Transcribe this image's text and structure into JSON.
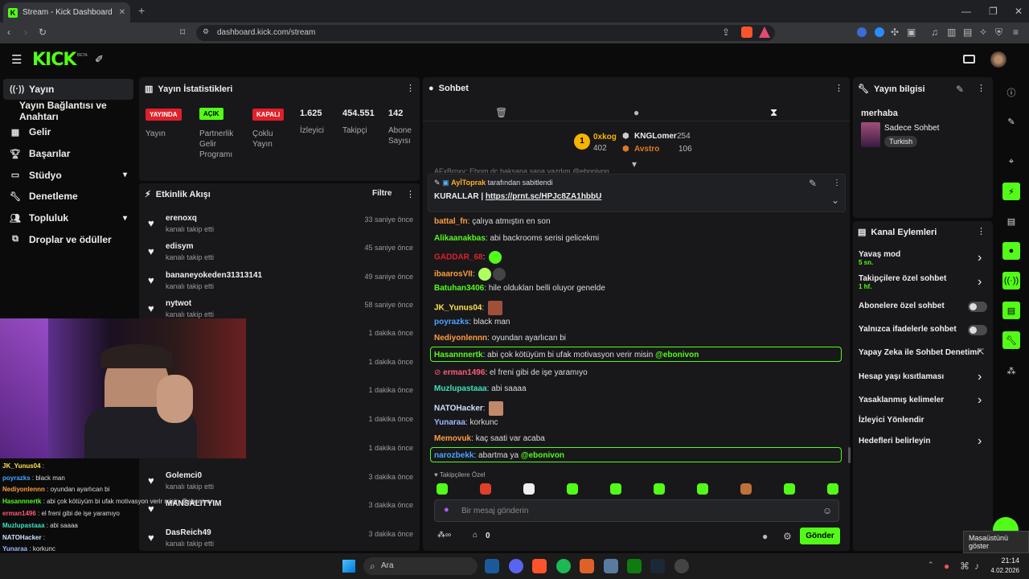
{
  "browser": {
    "tab_title": "Stream - Kick Dashboard",
    "new_tab": "+",
    "url": "dashboard.kick.com/stream"
  },
  "header": {
    "logo": "KICK",
    "beta": "BETA"
  },
  "sidebar": {
    "items": [
      {
        "label": "Yayın",
        "icon": "broadcast-icon"
      },
      {
        "label": "Yayın Bağlantısı ve Anahtarı",
        "icon": ""
      },
      {
        "label": "Gelir",
        "icon": "revenue-icon"
      },
      {
        "label": "Başarılar",
        "icon": "trophy-icon"
      },
      {
        "label": "Stüdyo",
        "icon": "studio-icon"
      },
      {
        "label": "Denetleme",
        "icon": "wrench-icon"
      },
      {
        "label": "Topluluk",
        "icon": "people-icon"
      },
      {
        "label": "Droplar ve ödüller",
        "icon": "drops-icon"
      }
    ]
  },
  "stats": {
    "title": "Yayın İstatistikleri",
    "badges": [
      {
        "badge": "YAYINDA",
        "label": "Yayın",
        "color": "#e0202a"
      },
      {
        "badge": "AÇIK",
        "label": "Partnerlik Gelir Programı",
        "color": "#53fc18"
      },
      {
        "badge": "KAPALI",
        "label": "Çoklu Yayın",
        "color": "#e0202a"
      }
    ],
    "nums": [
      {
        "value": "1.625",
        "label": "İzleyici"
      },
      {
        "value": "454.551",
        "label": "Takipçi"
      },
      {
        "value": "142",
        "label": "Abone Sayısı"
      }
    ]
  },
  "activity": {
    "title": "Etkinlik Akışı",
    "filter": "Filtre",
    "items": [
      {
        "name": "erenoxq",
        "sub": "kanalı takip etti",
        "time": "33 saniye önce"
      },
      {
        "name": "edisym",
        "sub": "kanalı takip etti",
        "time": "45 saniye önce"
      },
      {
        "name": "bananeyokeden31313141",
        "sub": "kanalı takip etti",
        "time": "49 saniye önce"
      },
      {
        "name": "nytwot",
        "sub": "kanalı takip etti",
        "time": "58 saniye önce"
      },
      {
        "name": "",
        "sub": "",
        "time": "1 dakika önce"
      },
      {
        "name": "",
        "sub": "",
        "time": "1 dakika önce"
      },
      {
        "name": "",
        "sub": "",
        "time": "1 dakika önce"
      },
      {
        "name": "",
        "sub": "",
        "time": "1 dakika önce"
      },
      {
        "name": "",
        "sub": "",
        "time": "1 dakika önce"
      },
      {
        "name": "Golemci0",
        "sub": "kanalı takip etti",
        "time": "3 dakika önce"
      },
      {
        "name": "MANSALITYIM",
        "sub": "",
        "time": "3 dakika önce"
      },
      {
        "name": "DasReich49",
        "sub": "kanalı takip etti",
        "time": "3 dakika önce"
      }
    ]
  },
  "chat": {
    "title": "Sohbet",
    "leaders": [
      {
        "name": "0xkog",
        "val": "402",
        "rank": "1"
      },
      {
        "name": "KNGLomer",
        "val": "254"
      },
      {
        "name": "Avstro",
        "val": "106"
      }
    ],
    "partial": "AFxBroxy: Ebom dc baksana sana yazdım @ebonivon",
    "pinned_by": "AyİToprak",
    "pinned_text": "tarafından sabitlendi",
    "rules_label": "KURALLAR |",
    "rules_link": "https://prnt.sc/HPJc8ZA1hbbU",
    "messages": [
      {
        "user": "battal_fn",
        "color": "#ff9d3b",
        "text": "çalıya atmıştın en son"
      },
      {
        "user": "Alikaanakbas",
        "color": "#53fc18",
        "text": "abi backrooms serisi gelicekmi"
      },
      {
        "user": "GADDAR_68",
        "color": "#e0202a",
        "text": ""
      },
      {
        "user": "ibaarosVII",
        "color": "#ff9d3b",
        "text": ""
      },
      {
        "user": "Batuhan3406",
        "color": "#53fc18",
        "text": "hile oldukları belli oluyor genelde"
      },
      {
        "user": "JK_Yunus04",
        "color": "#ffe04a",
        "text": ""
      },
      {
        "user": "poyrazks",
        "color": "#4aa3ff",
        "text": "black man"
      },
      {
        "user": "Nediyonlennn",
        "color": "#ff9d3b",
        "text": "oyundan ayarlıcan bi"
      },
      {
        "user": "Hasannnertk",
        "color": "#53fc18",
        "text": "abi çok kötüyüm bi ufak motivasyon verir misin",
        "mention": "@ebonivon"
      },
      {
        "user": "erman1496",
        "color": "#ff5a7a",
        "text": "el freni gibi de işe yaramıyo"
      },
      {
        "user": "Muzlupastaaa",
        "color": "#3fe0c0",
        "text": "abi saaaa"
      },
      {
        "user": "NATOHacker",
        "color": "#cfe3ff",
        "text": ""
      },
      {
        "user": "Yunaraa",
        "color": "#9fb8ff",
        "text": "korkunc"
      },
      {
        "user": "Memovuk",
        "color": "#ff9d3b",
        "text": "kaç saati var acaba"
      },
      {
        "user": "narozbekk",
        "color": "#4aa3ff",
        "text": "abartma ya",
        "mention": "@ebonivon"
      }
    ],
    "followers_only": "Takipçilere Özel",
    "input_placeholder": "Bir mesaj gönderin",
    "points": "0",
    "send": "Gönder"
  },
  "info": {
    "title": "Yayın bilgisi",
    "stream_title": "merhaba",
    "category": "Sadece Sohbet",
    "tag": "Turkish"
  },
  "actions": {
    "title": "Kanal Eylemleri",
    "items": [
      {
        "label": "Yavaş mod",
        "sub": "5 sn.",
        "kind": "chevron"
      },
      {
        "label": "Takipçilere özel sohbet",
        "sub": "1 hf.",
        "kind": "chevron"
      },
      {
        "label": "Abonelere özel sohbet",
        "sub": "",
        "kind": "toggle"
      },
      {
        "label": "Yalnızca ifadelerle sohbet",
        "sub": "",
        "kind": "toggle"
      },
      {
        "label": "Yapay Zeka ile Sohbet Denetimi",
        "sub": "",
        "kind": "external"
      },
      {
        "label": "Hesap yaşı kısıtlaması",
        "sub": "",
        "kind": "chevron"
      },
      {
        "label": "Yasaklanmış kelimeler",
        "sub": "",
        "kind": "chevron"
      },
      {
        "label": "İzleyici Yönlendir",
        "sub": "",
        "kind": "none"
      },
      {
        "label": "Hedefleri belirleyin",
        "sub": "",
        "kind": "chevron"
      }
    ]
  },
  "overlay": [
    {
      "user": "JK_Yunus04",
      "color": "#ffe04a",
      "text": ""
    },
    {
      "user": "poyrazks",
      "color": "#4aa3ff",
      "text": "black man"
    },
    {
      "user": "Nediyonlennn",
      "color": "#ff9d3b",
      "text": "oyundan ayarlıcan bi"
    },
    {
      "user": "Hasannnertk",
      "color": "#53fc18",
      "text": "abi çok kötüyüm bi ufak motivasyon verir misin @ebonivon"
    },
    {
      "user": "erman1496",
      "color": "#ff5a7a",
      "text": "el freni gibi de işe yaramıyo"
    },
    {
      "user": "Muzlupastaaa",
      "color": "#3fe0c0",
      "text": "abi saaaa"
    },
    {
      "user": "NATOHacker",
      "color": "#cfe3ff",
      "text": ""
    },
    {
      "user": "Yunaraa",
      "color": "#9fb8ff",
      "text": "korkunc"
    },
    {
      "user": "Memovuk",
      "color": "#ff9d3b",
      "text": "kaç saati var acaba"
    },
    {
      "user": "narozbekk",
      "color": "#4aa3ff",
      "text": "abartma ya @ebonivon"
    }
  ],
  "tooltip": "Masaüstünü göster",
  "taskbar": {
    "search": "Ara",
    "time": "21:14",
    "date": "4.02.2026"
  }
}
